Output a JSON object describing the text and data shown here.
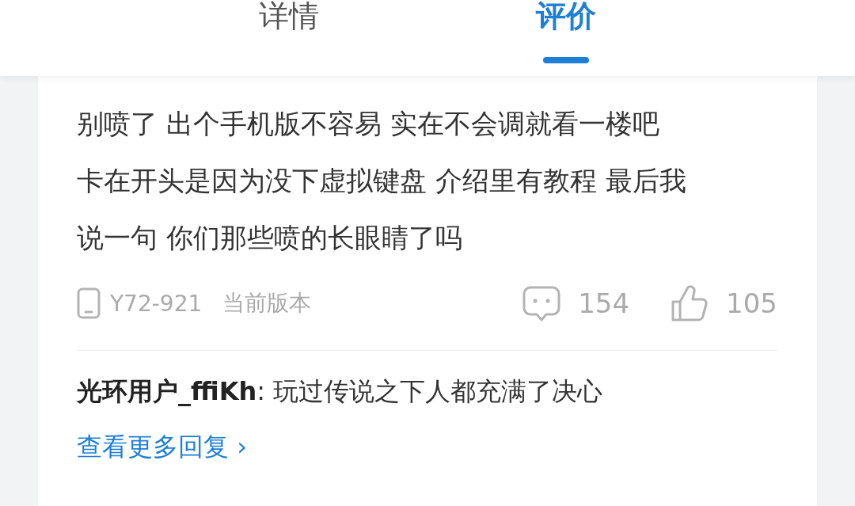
{
  "tabs": [
    {
      "label": "详情",
      "selected": false
    },
    {
      "label": "评价",
      "selected": true
    }
  ],
  "review": {
    "lines": [
      "别喷了 出个手机版不容易 实在不会调就看一楼吧",
      "卡在开头是因为没下虚拟键盘 介绍里有教程 最后我",
      "说一句 你们那些喷的长眼睛了吗"
    ],
    "device": "Y72-921",
    "version_label": "当前版本",
    "comment_count": "154",
    "like_count": "105"
  },
  "reply": {
    "user": "光环用户_ffiKh",
    "separator": ":",
    "text": "玩过传说之下人都充满了决心"
  },
  "more_replies": {
    "label": "查看更多回复",
    "chevron": "›"
  }
}
